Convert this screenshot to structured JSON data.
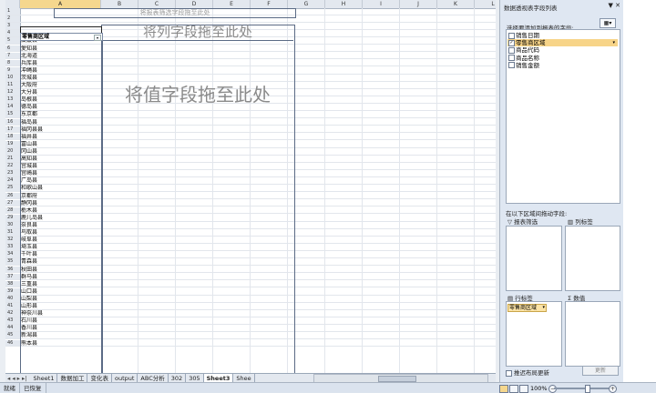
{
  "columns": [
    "A",
    "B",
    "C",
    "D",
    "E",
    "F",
    "G",
    "H",
    "I",
    "J",
    "K",
    "L",
    "M"
  ],
  "pivot": {
    "filter_drop": "将报表筛选字段拖至此处",
    "column_drop": "将列字段拖至此处",
    "value_drop": "将值字段拖至此处",
    "row_header": "零售商区域",
    "dropdown_icon": "▾"
  },
  "rows": [
    {
      "n": "1",
      "a": ""
    },
    {
      "n": "2",
      "a": ""
    },
    {
      "n": "3",
      "a": ""
    },
    {
      "n": "4",
      "a": ""
    },
    {
      "n": "5",
      "a": "爱媛县"
    },
    {
      "n": "6",
      "a": "愛知县"
    },
    {
      "n": "7",
      "a": "北海道"
    },
    {
      "n": "8",
      "a": "兵库县"
    },
    {
      "n": "9",
      "a": "冲绳县"
    },
    {
      "n": "10",
      "a": "茨城县"
    },
    {
      "n": "11",
      "a": "大阪府"
    },
    {
      "n": "12",
      "a": "大分县"
    },
    {
      "n": "13",
      "a": "岛根县"
    },
    {
      "n": "14",
      "a": "德岛县"
    },
    {
      "n": "15",
      "a": "东京都"
    },
    {
      "n": "16",
      "a": "福岛县"
    },
    {
      "n": "17",
      "a": "福冈县县"
    },
    {
      "n": "18",
      "a": "福井县"
    },
    {
      "n": "19",
      "a": "富山县"
    },
    {
      "n": "20",
      "a": "冈山县"
    },
    {
      "n": "21",
      "a": "高知县"
    },
    {
      "n": "22",
      "a": "宫城县"
    },
    {
      "n": "23",
      "a": "宫崎县"
    },
    {
      "n": "24",
      "a": "广岛县"
    },
    {
      "n": "25",
      "a": "和歌山县"
    },
    {
      "n": "26",
      "a": "京都府"
    },
    {
      "n": "27",
      "a": "静冈县"
    },
    {
      "n": "28",
      "a": "栃木县"
    },
    {
      "n": "29",
      "a": "鹿儿岛县"
    },
    {
      "n": "30",
      "a": "奈良县"
    },
    {
      "n": "31",
      "a": "鸟取县"
    },
    {
      "n": "32",
      "a": "岐阜县"
    },
    {
      "n": "33",
      "a": "埼玉县"
    },
    {
      "n": "34",
      "a": "千叶县"
    },
    {
      "n": "35",
      "a": "青森县"
    },
    {
      "n": "36",
      "a": "秋田县"
    },
    {
      "n": "37",
      "a": "群马县"
    },
    {
      "n": "38",
      "a": "三重县"
    },
    {
      "n": "39",
      "a": "山口县"
    },
    {
      "n": "40",
      "a": "山梨县"
    },
    {
      "n": "41",
      "a": "山形县"
    },
    {
      "n": "42",
      "a": "神奈川县"
    },
    {
      "n": "43",
      "a": "石川县"
    },
    {
      "n": "44",
      "a": "香川县"
    },
    {
      "n": "45",
      "a": "新潟县"
    },
    {
      "n": "46",
      "a": "熊本县"
    }
  ],
  "tabs": {
    "nav": "◂ ◂ ▸ ▸|",
    "items": [
      "Sheet1",
      "数据加工",
      "变化表",
      "output",
      "ABC分析",
      "302",
      "305",
      "Sheet3",
      "Shee"
    ],
    "active": "Sheet3"
  },
  "status": {
    "ready": "就绪",
    "recover": "已恢复",
    "zoom": "100%",
    "zoom_minus": "−",
    "zoom_plus": "+"
  },
  "pane": {
    "title": "数据透视表字段列表",
    "controls": "▼ ✕",
    "subtitle": "选择要添加到报表的字段:",
    "layout_btn": "▦▾",
    "fields": [
      {
        "label": "销售日期",
        "checked": false,
        "selected": false
      },
      {
        "label": "零售商区域",
        "checked": true,
        "selected": true
      },
      {
        "label": "商品代码",
        "checked": false,
        "selected": false
      },
      {
        "label": "商品名称",
        "checked": false,
        "selected": false
      },
      {
        "label": "销售金额",
        "checked": false,
        "selected": false
      }
    ],
    "check_mark": "✓",
    "drag_label": "在以下区域间拖动字段:",
    "report_filter": "报表筛选",
    "column_labels": "列标签",
    "row_labels": "行标签",
    "values": "数值",
    "row_chip": "零售商区域",
    "defer": "推迟布局更新",
    "update": "更新"
  }
}
